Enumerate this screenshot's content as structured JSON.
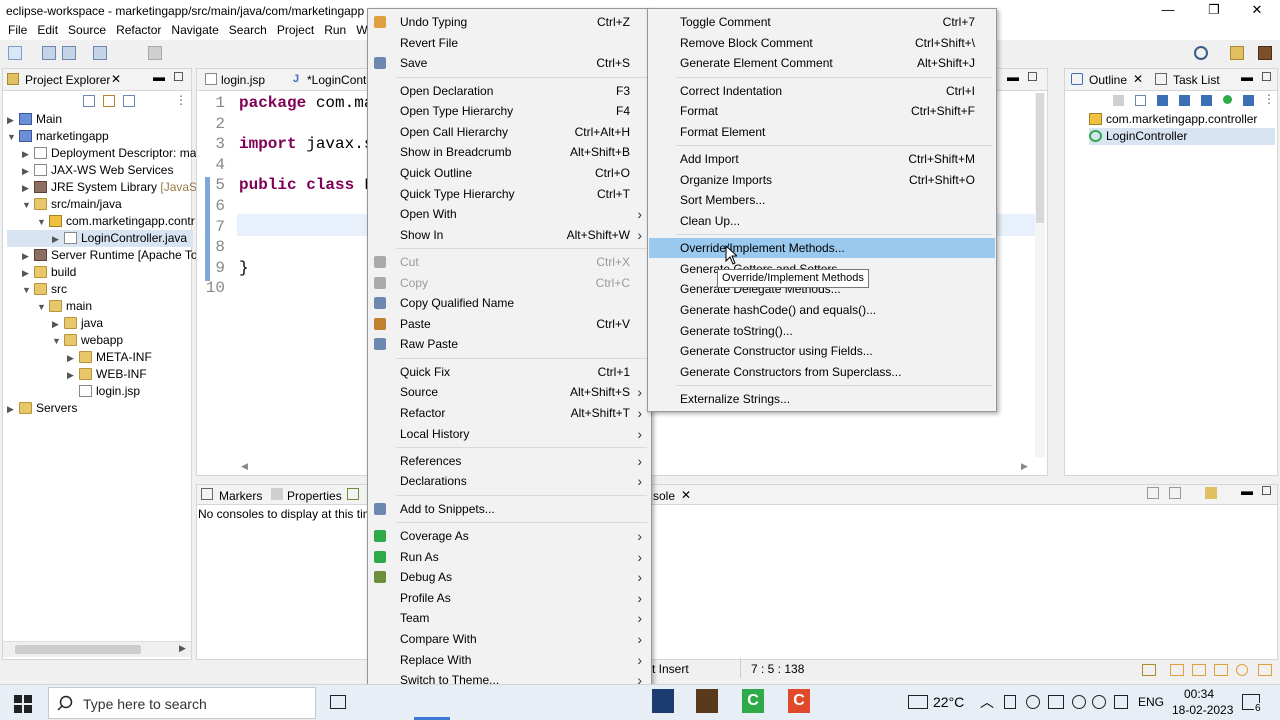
{
  "window": {
    "title": "eclipse-workspace - marketingapp/src/main/java/com/marketingapp",
    "minimize": "—",
    "maximize": "❐",
    "close": "✕"
  },
  "menubar": [
    "File",
    "Edit",
    "Source",
    "Refactor",
    "Navigate",
    "Search",
    "Project",
    "Run",
    "W"
  ],
  "project_explorer": {
    "tab_label": "Project Explorer",
    "items": [
      {
        "label": "Main"
      },
      {
        "label": "marketingapp"
      },
      {
        "label": "Deployment Descriptor: ma"
      },
      {
        "label": "JAX-WS Web Services"
      },
      {
        "label": "JRE System Library",
        "extra": "[JavaSE-1"
      },
      {
        "label": "src/main/java"
      },
      {
        "label": "com.marketingapp.contr"
      },
      {
        "label": "LoginController.java"
      },
      {
        "label": "Server Runtime [Apache Tor"
      },
      {
        "label": "build"
      },
      {
        "label": "src"
      },
      {
        "label": "main"
      },
      {
        "label": "java"
      },
      {
        "label": "webapp"
      },
      {
        "label": "META-INF"
      },
      {
        "label": "WEB-INF"
      },
      {
        "label": "login.jsp"
      },
      {
        "label": "Servers"
      }
    ]
  },
  "editor": {
    "tabs": [
      "login.jsp",
      "*LoginCont"
    ],
    "lines": [
      "1",
      "2",
      "3",
      "4",
      "5",
      "6",
      "7",
      "8",
      "9",
      "10"
    ],
    "code": {
      "l1_kw": "package",
      "l1_rest": " com.ma",
      "l3_kw": "import",
      "l3_rest": " javax.s",
      "l5_kw": "public class",
      "l5_rest": " L",
      "l9": "}"
    }
  },
  "outline": {
    "tab_label": "Outline",
    "tasklist_label": "Task List",
    "items": [
      "com.marketingapp.controller",
      "LoginController"
    ]
  },
  "bottom": {
    "tabs": [
      "Markers",
      "Properties"
    ],
    "console_tab": "sole",
    "message": "No consoles to display at this time",
    "status_mode": "rt Insert",
    "status_pos": "7 : 5 : 138"
  },
  "context_menu": [
    {
      "label": "Undo Typing",
      "shortcut": "Ctrl+Z"
    },
    {
      "label": "Revert File"
    },
    {
      "label": "Save",
      "shortcut": "Ctrl+S"
    },
    {
      "sep": true
    },
    {
      "label": "Open Declaration",
      "shortcut": "F3"
    },
    {
      "label": "Open Type Hierarchy",
      "shortcut": "F4"
    },
    {
      "label": "Open Call Hierarchy",
      "shortcut": "Ctrl+Alt+H"
    },
    {
      "label": "Show in Breadcrumb",
      "shortcut": "Alt+Shift+B"
    },
    {
      "label": "Quick Outline",
      "shortcut": "Ctrl+O"
    },
    {
      "label": "Quick Type Hierarchy",
      "shortcut": "Ctrl+T"
    },
    {
      "label": "Open With",
      "sub": true
    },
    {
      "label": "Show In",
      "shortcut": "Alt+Shift+W",
      "sub": true
    },
    {
      "sep": true
    },
    {
      "label": "Cut",
      "shortcut": "Ctrl+X",
      "disabled": true
    },
    {
      "label": "Copy",
      "shortcut": "Ctrl+C",
      "disabled": true
    },
    {
      "label": "Copy Qualified Name"
    },
    {
      "label": "Paste",
      "shortcut": "Ctrl+V"
    },
    {
      "label": "Raw Paste"
    },
    {
      "sep": true
    },
    {
      "label": "Quick Fix",
      "shortcut": "Ctrl+1"
    },
    {
      "label": "Source",
      "shortcut": "Alt+Shift+S",
      "sub": true
    },
    {
      "label": "Refactor",
      "shortcut": "Alt+Shift+T",
      "sub": true
    },
    {
      "label": "Local History",
      "sub": true
    },
    {
      "sep": true
    },
    {
      "label": "References",
      "sub": true
    },
    {
      "label": "Declarations",
      "sub": true
    },
    {
      "sep": true
    },
    {
      "label": "Add to Snippets..."
    },
    {
      "sep": true
    },
    {
      "label": "Coverage As",
      "sub": true
    },
    {
      "label": "Run As",
      "sub": true
    },
    {
      "label": "Debug As",
      "sub": true
    },
    {
      "label": "Profile As",
      "sub": true
    },
    {
      "label": "Team",
      "sub": true
    },
    {
      "label": "Compare With",
      "sub": true
    },
    {
      "label": "Replace With",
      "sub": true
    },
    {
      "label": "Switch to Theme...",
      "sub": true
    }
  ],
  "source_menu": [
    {
      "label": "Toggle Comment",
      "shortcut": "Ctrl+7"
    },
    {
      "label": "Remove Block Comment",
      "shortcut": "Ctrl+Shift+\\"
    },
    {
      "label": "Generate Element Comment",
      "shortcut": "Alt+Shift+J"
    },
    {
      "sep": true
    },
    {
      "label": "Correct Indentation",
      "shortcut": "Ctrl+I"
    },
    {
      "label": "Format",
      "shortcut": "Ctrl+Shift+F"
    },
    {
      "label": "Format Element"
    },
    {
      "sep": true
    },
    {
      "label": "Add Import",
      "shortcut": "Ctrl+Shift+M"
    },
    {
      "label": "Organize Imports",
      "shortcut": "Ctrl+Shift+O"
    },
    {
      "label": "Sort Members..."
    },
    {
      "label": "Clean Up..."
    },
    {
      "sep": true
    },
    {
      "label": "Override/Implement Methods...",
      "selected": true
    },
    {
      "label": "Generate Getters and Setters..."
    },
    {
      "label": "Generate Delegate Methods..."
    },
    {
      "label": "Generate hashCode() and equals()..."
    },
    {
      "label": "Generate toString()..."
    },
    {
      "label": "Generate Constructor using Fields..."
    },
    {
      "label": "Generate Constructors from Superclass..."
    },
    {
      "sep": true
    },
    {
      "label": "Externalize Strings..."
    }
  ],
  "tooltip": "Override/Implement Methods",
  "taskbar": {
    "search_placeholder": "Type here to search",
    "weather": "22°C",
    "lang": "ENG",
    "time": "00:34",
    "date": "18-02-2023",
    "notif_count": "6"
  }
}
